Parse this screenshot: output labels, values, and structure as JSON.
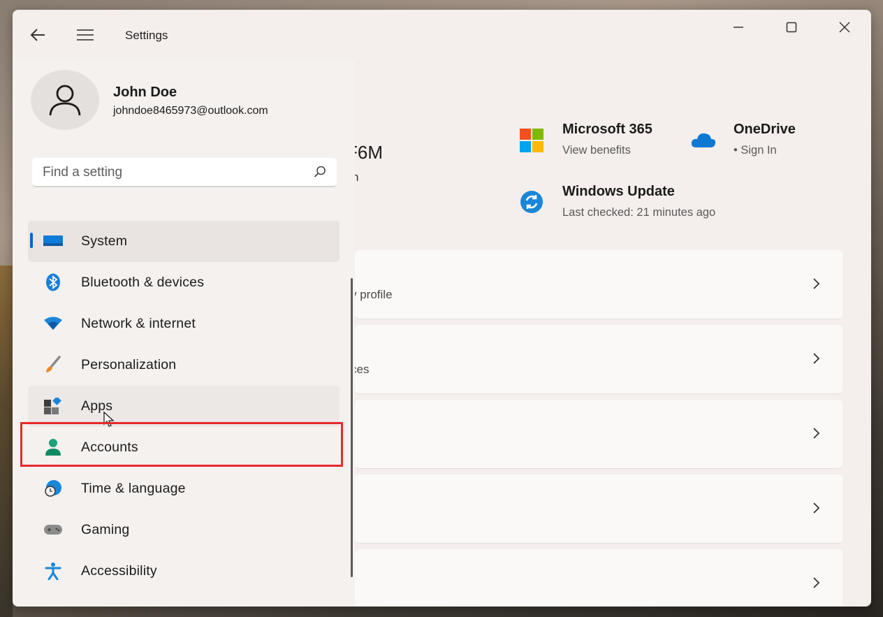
{
  "window": {
    "title": "Settings"
  },
  "user": {
    "name": "John Doe",
    "email": "johndoe8465973@outlook.com"
  },
  "search": {
    "placeholder": "Find a setting"
  },
  "nav": {
    "items": [
      {
        "label": "System",
        "icon": "system-icon",
        "selected": true
      },
      {
        "label": "Bluetooth & devices",
        "icon": "bluetooth-icon"
      },
      {
        "label": "Network & internet",
        "icon": "wifi-icon"
      },
      {
        "label": "Personalization",
        "icon": "brush-icon"
      },
      {
        "label": "Apps",
        "icon": "apps-icon",
        "highlighted": true
      },
      {
        "label": "Accounts",
        "icon": "person-icon"
      },
      {
        "label": "Time & language",
        "icon": "clock-globe-icon"
      },
      {
        "label": "Gaming",
        "icon": "gamepad-icon"
      },
      {
        "label": "Accessibility",
        "icon": "accessibility-icon"
      }
    ]
  },
  "main": {
    "device_name_partial": "F6M",
    "device_sub_partial": "n",
    "tiles": {
      "ms365": {
        "title": "Microsoft 365",
        "sub": "View benefits"
      },
      "onedrive": {
        "title": "OneDrive",
        "sub": "• Sign In"
      },
      "update": {
        "title": "Windows Update",
        "sub": "Last checked: 21 minutes ago"
      }
    },
    "cards": [
      {
        "sub": "y profile"
      },
      {
        "sub": "ces"
      },
      {
        "sub": ""
      },
      {
        "sub": ""
      },
      {
        "sub": ""
      }
    ]
  },
  "colors": {
    "accent": "#0b66c2",
    "highlight_box": "#e52b2b",
    "window_bg": "#f4efec"
  }
}
